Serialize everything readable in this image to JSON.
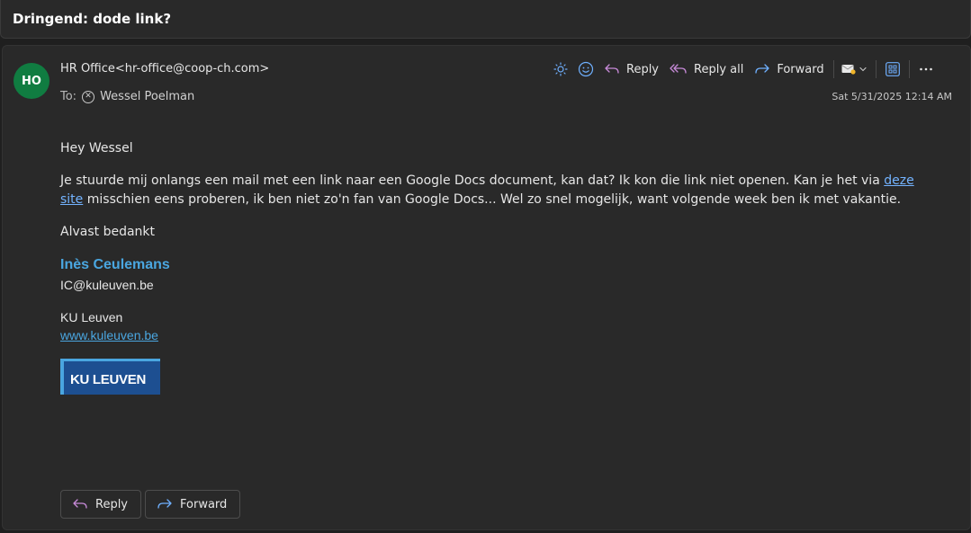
{
  "subject": "Dringend: dode link?",
  "message": {
    "avatar_initials": "HO",
    "sender": "HR Office<hr-office@coop-ch.com>",
    "to_label": "To:",
    "recipient": "Wessel Poelman",
    "date": "Sat 5/31/2025 12:14 AM"
  },
  "toolbar": {
    "reply": "Reply",
    "reply_all": "Reply all",
    "forward": "Forward"
  },
  "body": {
    "greeting": "Hey Wessel",
    "paragraph_before_link": "Je stuurde mij onlangs een mail met een link naar een Google Docs document, kan dat? Ik kon die link niet openen. Kan je het via ",
    "link_text": "deze site",
    "paragraph_after_link": " misschien eens proberen, ik ben niet zo'n fan van Google Docs... Wel zo snel mogelijk, want volgende week ben ik met vakantie.",
    "thanks": "Alvast bedankt"
  },
  "signature": {
    "name": "Inès Ceulemans",
    "email": "IC@kuleuven.be",
    "org": "KU Leuven",
    "website": "www.kuleuven.be",
    "logo_text": "KU LEUVEN"
  },
  "actions": {
    "reply": "Reply",
    "forward": "Forward"
  },
  "colors": {
    "avatar": "#107c41",
    "accent": "#4aa6e0",
    "link": "#73b3ff",
    "reply_icon": "#c78ad8",
    "forward_icon": "#6fb0ff"
  }
}
